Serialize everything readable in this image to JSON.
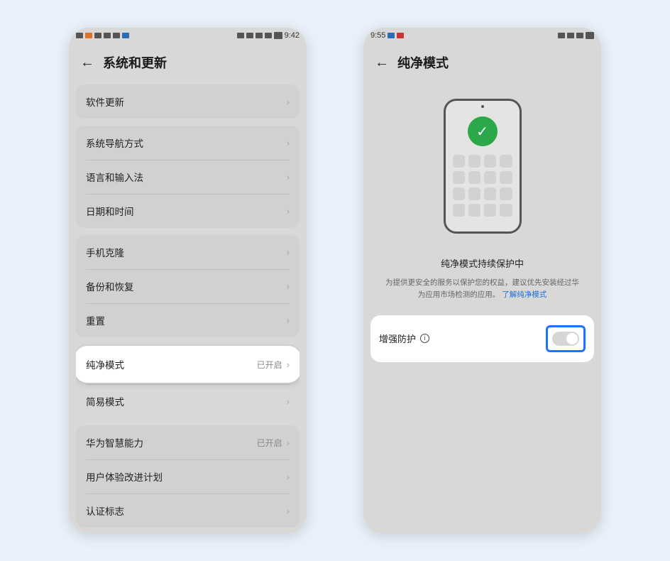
{
  "phone1": {
    "statusbar": {
      "time": "9:42"
    },
    "header": {
      "title": "系统和更新"
    },
    "groups": [
      {
        "rows": [
          {
            "label": "软件更新",
            "status": ""
          }
        ]
      },
      {
        "rows": [
          {
            "label": "系统导航方式",
            "status": ""
          },
          {
            "label": "语言和输入法",
            "status": ""
          },
          {
            "label": "日期和时间",
            "status": ""
          }
        ]
      },
      {
        "rows": [
          {
            "label": "手机克隆",
            "status": ""
          },
          {
            "label": "备份和恢复",
            "status": ""
          },
          {
            "label": "重置",
            "status": ""
          }
        ]
      },
      {
        "rows": [
          {
            "label": "纯净模式",
            "status": "已开启",
            "highlight": true
          },
          {
            "label": "简易模式",
            "status": ""
          }
        ]
      },
      {
        "rows": [
          {
            "label": "华为智慧能力",
            "status": "已开启"
          },
          {
            "label": "用户体验改进计划",
            "status": ""
          },
          {
            "label": "认证标志",
            "status": ""
          }
        ]
      }
    ]
  },
  "phone2": {
    "statusbar": {
      "time": "9:55"
    },
    "header": {
      "title": "纯净模式"
    },
    "protect": {
      "title": "纯净模式持续保护中",
      "desc_a": "为提供更安全的服务以保护您的权益，建议优先安装经过华",
      "desc_b": "为应用市场检测的应用。",
      "link": "了解纯净模式"
    },
    "enhance": {
      "label": "增强防护"
    }
  }
}
